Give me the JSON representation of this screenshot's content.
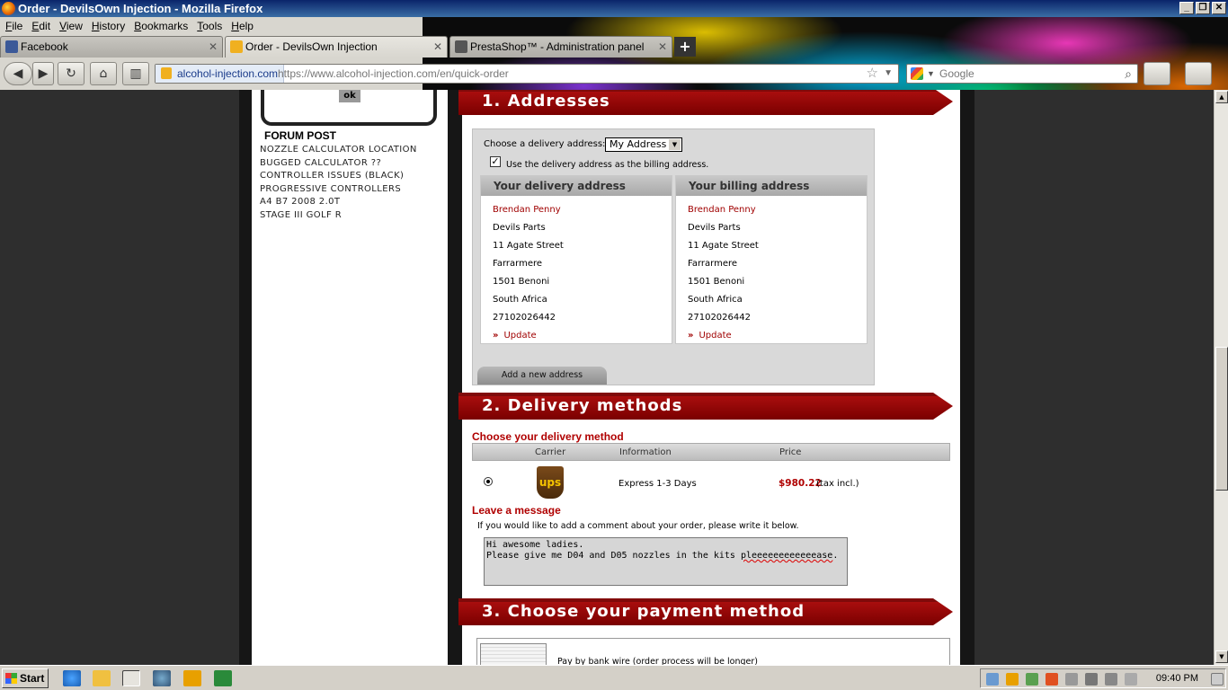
{
  "window": {
    "title": "Order - DevilsOwn Injection - Mozilla Firefox",
    "min": "_",
    "max": "❐",
    "close": "✕"
  },
  "menu": [
    "File",
    "Edit",
    "View",
    "History",
    "Bookmarks",
    "Tools",
    "Help"
  ],
  "tabs": [
    {
      "label": "Facebook"
    },
    {
      "label": "Order - DevilsOwn Injection"
    },
    {
      "label": "PrestaShop™ - Administration panel"
    }
  ],
  "new_tab": "+",
  "nav": {
    "site_identity": "alcohol-injection.com",
    "url": "https://www.alcohol-injection.com/en/quick-order",
    "search_placeholder": "Google"
  },
  "sidebar": {
    "ok_label": "ok",
    "forum_title": "FORUM POST",
    "forum_items": [
      "NOZZLE CALCULATOR LOCATION",
      "BUGGED CALCULATOR ??",
      "CONTROLLER ISSUES (BLACK)",
      "PROGRESSIVE CONTROLLERS",
      "A4 B7 2008 2.0T",
      "STAGE III GOLF R"
    ]
  },
  "addresses": {
    "section_title": "1. Addresses",
    "choose_label": "Choose a delivery address:",
    "selected": "My Address",
    "same_billing_label": "Use the delivery address as the billing address.",
    "delivery": {
      "heading": "Your delivery address",
      "lines": [
        "Brendan Penny",
        "Devils Parts",
        "11 Agate Street",
        "Farrarmere",
        "1501 Benoni",
        "South Africa",
        "27102026442"
      ],
      "update": "Update"
    },
    "billing": {
      "heading": "Your billing address",
      "lines": [
        "Brendan Penny",
        "Devils Parts",
        "11 Agate Street",
        "Farrarmere",
        "1501 Benoni",
        "South Africa",
        "27102026442"
      ],
      "update": "Update"
    },
    "add_button": "Add a new address"
  },
  "delivery": {
    "section_title": "2. Delivery methods",
    "choose_label": "Choose your delivery method",
    "columns": {
      "carrier": "Carrier",
      "information": "Information",
      "price": "Price"
    },
    "carrier_logo": "ups",
    "information": "Express 1-3 Days",
    "price": "$980.22",
    "tax_note": "(tax incl.)"
  },
  "message": {
    "label": "Leave a message",
    "hint": "If you would like to add a comment about your order, please write it below.",
    "line1": "Hi awesome ladies.",
    "line2_prefix": "Please give me D04 and D05 nozzles in the kits ",
    "line2_misspelled": "pleeeeeeeeeeeease",
    "line2_suffix": "."
  },
  "payment": {
    "section_title": "3. Choose your payment method",
    "option_label": "Pay by bank wire (order process will be longer)"
  },
  "taskbar": {
    "start": "Start",
    "clock": "09:40 PM"
  },
  "icons": {
    "facebook": "#3b5998",
    "prestashop": "#555555",
    "accent_red": "#b00000"
  }
}
